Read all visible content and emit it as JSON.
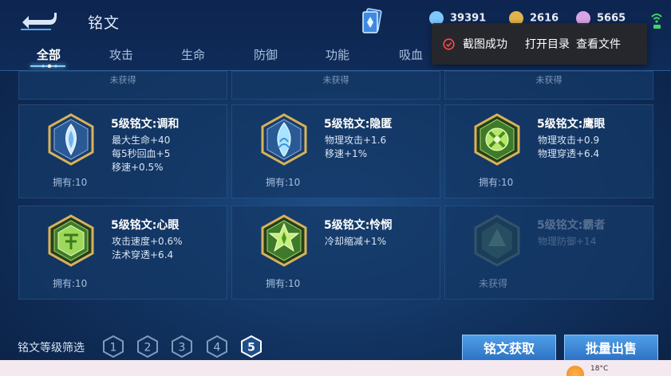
{
  "header": {
    "title": "铭文",
    "currencies": [
      {
        "icon": "diamond-icon",
        "value": "39391",
        "color": "#7ec8ff"
      },
      {
        "icon": "gold-coin-icon",
        "value": "2616",
        "color": "#e0b44a"
      },
      {
        "icon": "pink-crystal-icon",
        "value": "5665",
        "color": "#d9a4e6"
      }
    ]
  },
  "tabs": [
    {
      "label": "全部",
      "active": true
    },
    {
      "label": "攻击",
      "active": false
    },
    {
      "label": "生命",
      "active": false
    },
    {
      "label": "防御",
      "active": false
    },
    {
      "label": "功能",
      "active": false
    },
    {
      "label": "吸血",
      "active": false
    }
  ],
  "toast": {
    "message": "截图成功",
    "open_dir": "打开目录",
    "view_file": "查看文件"
  },
  "partial_row": [
    "未获得",
    "未获得",
    "未获得"
  ],
  "runes": [
    {
      "name": "5级铭文:调和",
      "stats": [
        "最大生命+40",
        "每5秒回血+5",
        "移速+0.5%"
      ],
      "owned": "拥有:10",
      "color": "blue",
      "icon": "harmony-rune-icon"
    },
    {
      "name": "5级铭文:隐匿",
      "stats": [
        "物理攻击+1.6",
        "移速+1%"
      ],
      "owned": "拥有:10",
      "color": "blue",
      "icon": "stealth-rune-icon"
    },
    {
      "name": "5级铭文:鹰眼",
      "stats": [
        "物理攻击+0.9",
        "物理穿透+6.4"
      ],
      "owned": "拥有:10",
      "color": "green",
      "icon": "hawkeye-rune-icon"
    },
    {
      "name": "5级铭文:心眼",
      "stats": [
        "攻击速度+0.6%",
        "法术穿透+6.4"
      ],
      "owned": "拥有:10",
      "color": "green",
      "icon": "mind-eye-rune-icon"
    },
    {
      "name": "5级铭文:怜悯",
      "stats": [
        "冷却缩减+1%"
      ],
      "owned": "拥有:10",
      "color": "green",
      "icon": "mercy-rune-icon"
    },
    {
      "name": "5级铭文:霸者",
      "stats": [
        "物理防御+14"
      ],
      "owned": "未获得",
      "color": "green",
      "icon": "overlord-rune-icon",
      "locked": true
    }
  ],
  "filter": {
    "label": "铭文等级筛选",
    "levels": [
      "1",
      "2",
      "3",
      "4",
      "5"
    ],
    "selected": "5"
  },
  "buttons": {
    "obtain": "铭文获取",
    "batch_sell": "批量出售"
  },
  "taskbar": {
    "temperature": "18°C"
  }
}
